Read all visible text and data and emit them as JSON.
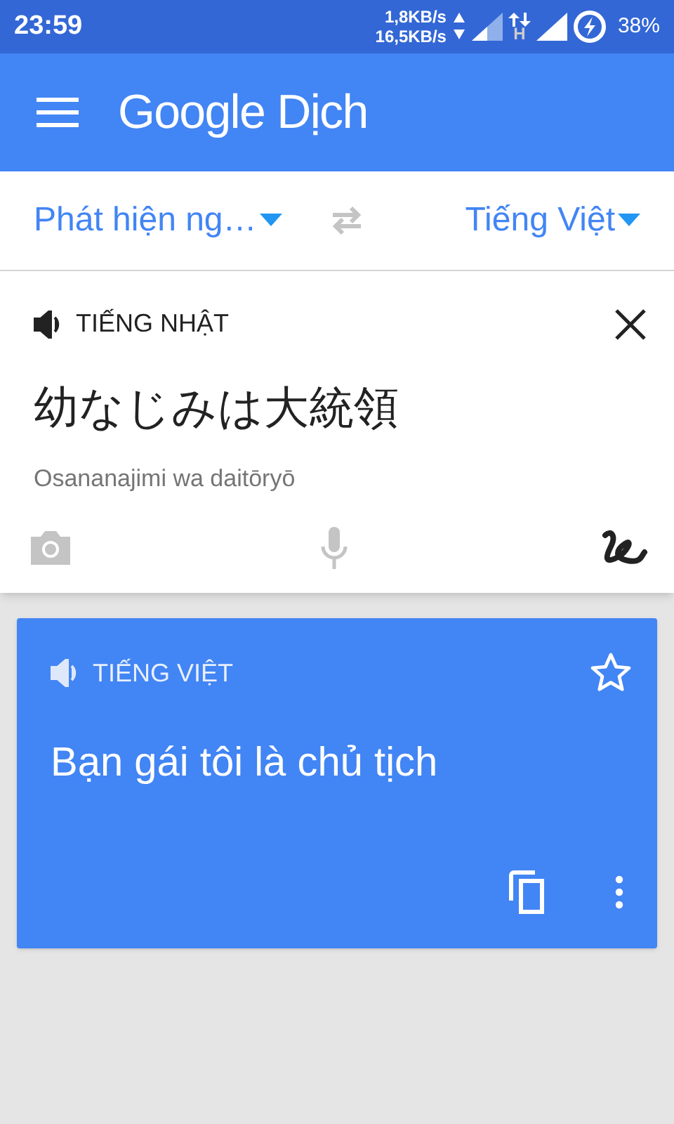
{
  "status_bar": {
    "time": "23:59",
    "upload_speed": "1,8KB/s",
    "download_speed": "16,5KB/s",
    "network_type": "H",
    "battery": "38%"
  },
  "app_bar": {
    "title": "Google Dịch"
  },
  "languages": {
    "source": "Phát hiện ng…",
    "target": "Tiếng Việt"
  },
  "input": {
    "language": "TIẾNG NHẬT",
    "text": "幼なじみは大統領",
    "romanization": "Osananajimi wa daitōryō"
  },
  "result": {
    "language": "TIẾNG VIỆT",
    "text": "Bạn gái tôi là chủ tịch",
    "starred": false
  }
}
